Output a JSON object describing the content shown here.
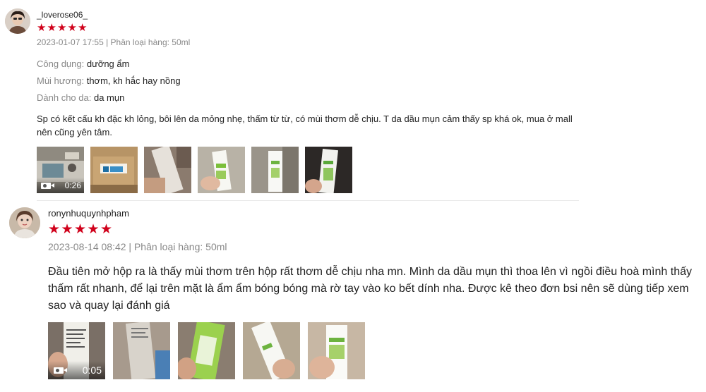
{
  "reviews": [
    {
      "username": "_loverose06_",
      "rating": 5,
      "stars": [
        "★",
        "★",
        "★",
        "★",
        "★"
      ],
      "date": "2023-01-07 17:55",
      "variation": "Phân loại hàng: 50ml",
      "attributes": [
        {
          "label": "Công dụng:",
          "value": "dưỡng ẩm"
        },
        {
          "label": "Mùi hương:",
          "value": "thơm, kh hắc hay nồng"
        },
        {
          "label": "Dành cho da:",
          "value": "da mụn"
        }
      ],
      "text": "Sp có kết cấu kh đặc kh lỏng, bôi lên da mỏng nhẹ, thấm từ từ, có mùi thơm dễ chịu. T da dầu mụn cảm thấy sp khá ok, mua ở mall nên cũng yên tâm.",
      "video_duration": "0:26",
      "media": [
        "video",
        "photo",
        "photo",
        "photo",
        "photo",
        "photo"
      ]
    },
    {
      "username": "ronynhuquynhpham",
      "rating": 5,
      "stars": [
        "★",
        "★",
        "★",
        "★",
        "★"
      ],
      "date": "2023-08-14 08:42",
      "variation": "Phân loại hàng: 50ml",
      "text": "Đầu tiên mở hộp ra là thấy mùi thơm trên hộp rất thơm dễ chịu nha mn. Mình da dầu mụn thì thoa lên vì ngồi điều hoà mình thấy thấm rất nhanh, để lại trên mặt là ẩm ẩm bóng bóng mà rờ tay vào ko bết dính nha. Được kê theo đơn bsi nên sẽ dùng  tiếp xem sao và quay lại đánh giá",
      "video_duration": "0:05",
      "media": [
        "video",
        "photo",
        "photo",
        "photo",
        "photo"
      ]
    }
  ],
  "colors": {
    "star": "#d0011b",
    "meta_text": "#888888",
    "body_text": "#222222",
    "divider": "#e8e8e8"
  },
  "icons": {
    "video": "video-camera-icon",
    "star": "star-icon"
  }
}
